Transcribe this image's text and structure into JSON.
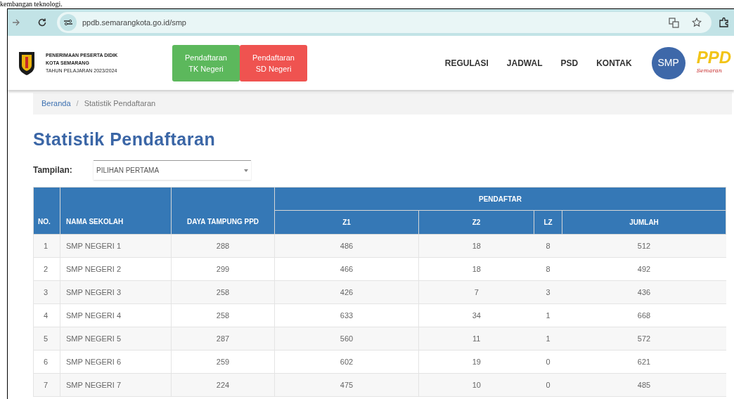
{
  "document_text": "kembangan teknologi.",
  "browser": {
    "url": "ppdb.semarangkota.go.id/smp"
  },
  "header": {
    "title_lines": [
      "PENERIMAAN PESERTA DIDIK",
      "KOTA SEMARANG",
      "TAHUN PELAJARAN 2023/2024"
    ],
    "buttons": [
      {
        "label": "Pendaftaran TK Negeri",
        "color": "#5cb85c"
      },
      {
        "label": "Pendaftaran SD Negeri",
        "color": "#ef5350"
      }
    ],
    "nav": [
      "REGULASI",
      "JADWAL",
      "PSD",
      "KONTAK"
    ],
    "level_badge": "SMP",
    "logo": {
      "text": "PPD",
      "tagline": "Semaran"
    }
  },
  "breadcrumb_separator": "/",
  "breadcrumb": [
    {
      "label": "Beranda",
      "kind": "link"
    },
    {
      "label": "Statistik Pendaftaran",
      "kind": "current"
    }
  ],
  "title": "Statistik Pendaftaran",
  "filter": {
    "label": "Tampilan:",
    "value": "PILIHAN PERTAMA"
  },
  "table": {
    "group_header": "PENDAFTAR",
    "columns": [
      "NO.",
      "NAMA SEKOLAH",
      "DAYA TAMPUNG PPD",
      "Z1",
      "Z2",
      "LZ",
      "JUMLAH"
    ],
    "rows": [
      [
        "1",
        "SMP NEGERI 1",
        "288",
        "486",
        "18",
        "8",
        "512"
      ],
      [
        "2",
        "SMP NEGERI 2",
        "299",
        "466",
        "18",
        "8",
        "492"
      ],
      [
        "3",
        "SMP NEGERI 3",
        "258",
        "426",
        "7",
        "3",
        "436"
      ],
      [
        "4",
        "SMP NEGERI 4",
        "258",
        "633",
        "34",
        "1",
        "668"
      ],
      [
        "5",
        "SMP NEGERI 5",
        "287",
        "560",
        "11",
        "1",
        "572"
      ],
      [
        "6",
        "SMP NEGERI 6",
        "259",
        "602",
        "19",
        "0",
        "621"
      ],
      [
        "7",
        "SMP NEGERI 7",
        "224",
        "475",
        "10",
        "0",
        "485"
      ]
    ]
  }
}
